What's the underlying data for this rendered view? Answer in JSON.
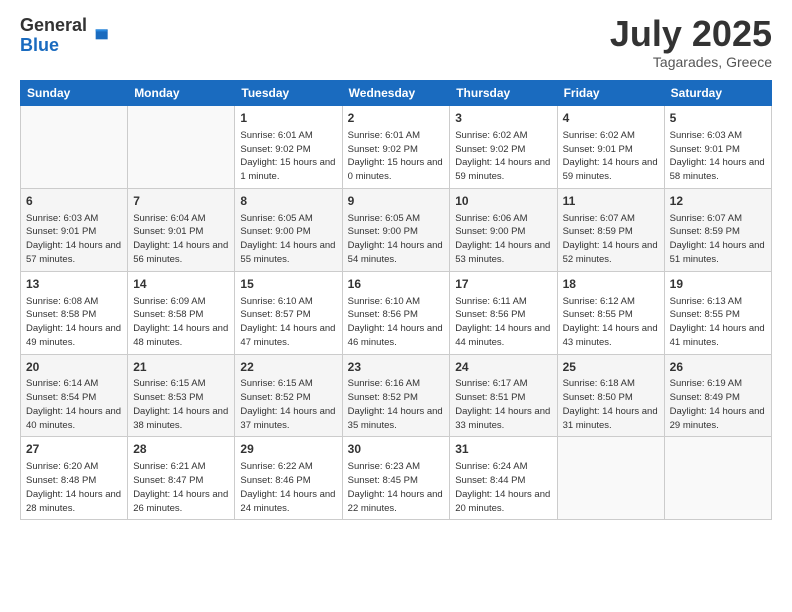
{
  "logo": {
    "general": "General",
    "blue": "Blue"
  },
  "header": {
    "month": "July 2025",
    "location": "Tagarades, Greece"
  },
  "weekdays": [
    "Sunday",
    "Monday",
    "Tuesday",
    "Wednesday",
    "Thursday",
    "Friday",
    "Saturday"
  ],
  "weeks": [
    [
      {
        "day": "",
        "info": ""
      },
      {
        "day": "",
        "info": ""
      },
      {
        "day": "1",
        "info": "Sunrise: 6:01 AM\nSunset: 9:02 PM\nDaylight: 15 hours and 1 minute."
      },
      {
        "day": "2",
        "info": "Sunrise: 6:01 AM\nSunset: 9:02 PM\nDaylight: 15 hours and 0 minutes."
      },
      {
        "day": "3",
        "info": "Sunrise: 6:02 AM\nSunset: 9:02 PM\nDaylight: 14 hours and 59 minutes."
      },
      {
        "day": "4",
        "info": "Sunrise: 6:02 AM\nSunset: 9:01 PM\nDaylight: 14 hours and 59 minutes."
      },
      {
        "day": "5",
        "info": "Sunrise: 6:03 AM\nSunset: 9:01 PM\nDaylight: 14 hours and 58 minutes."
      }
    ],
    [
      {
        "day": "6",
        "info": "Sunrise: 6:03 AM\nSunset: 9:01 PM\nDaylight: 14 hours and 57 minutes."
      },
      {
        "day": "7",
        "info": "Sunrise: 6:04 AM\nSunset: 9:01 PM\nDaylight: 14 hours and 56 minutes."
      },
      {
        "day": "8",
        "info": "Sunrise: 6:05 AM\nSunset: 9:00 PM\nDaylight: 14 hours and 55 minutes."
      },
      {
        "day": "9",
        "info": "Sunrise: 6:05 AM\nSunset: 9:00 PM\nDaylight: 14 hours and 54 minutes."
      },
      {
        "day": "10",
        "info": "Sunrise: 6:06 AM\nSunset: 9:00 PM\nDaylight: 14 hours and 53 minutes."
      },
      {
        "day": "11",
        "info": "Sunrise: 6:07 AM\nSunset: 8:59 PM\nDaylight: 14 hours and 52 minutes."
      },
      {
        "day": "12",
        "info": "Sunrise: 6:07 AM\nSunset: 8:59 PM\nDaylight: 14 hours and 51 minutes."
      }
    ],
    [
      {
        "day": "13",
        "info": "Sunrise: 6:08 AM\nSunset: 8:58 PM\nDaylight: 14 hours and 49 minutes."
      },
      {
        "day": "14",
        "info": "Sunrise: 6:09 AM\nSunset: 8:58 PM\nDaylight: 14 hours and 48 minutes."
      },
      {
        "day": "15",
        "info": "Sunrise: 6:10 AM\nSunset: 8:57 PM\nDaylight: 14 hours and 47 minutes."
      },
      {
        "day": "16",
        "info": "Sunrise: 6:10 AM\nSunset: 8:56 PM\nDaylight: 14 hours and 46 minutes."
      },
      {
        "day": "17",
        "info": "Sunrise: 6:11 AM\nSunset: 8:56 PM\nDaylight: 14 hours and 44 minutes."
      },
      {
        "day": "18",
        "info": "Sunrise: 6:12 AM\nSunset: 8:55 PM\nDaylight: 14 hours and 43 minutes."
      },
      {
        "day": "19",
        "info": "Sunrise: 6:13 AM\nSunset: 8:55 PM\nDaylight: 14 hours and 41 minutes."
      }
    ],
    [
      {
        "day": "20",
        "info": "Sunrise: 6:14 AM\nSunset: 8:54 PM\nDaylight: 14 hours and 40 minutes."
      },
      {
        "day": "21",
        "info": "Sunrise: 6:15 AM\nSunset: 8:53 PM\nDaylight: 14 hours and 38 minutes."
      },
      {
        "day": "22",
        "info": "Sunrise: 6:15 AM\nSunset: 8:52 PM\nDaylight: 14 hours and 37 minutes."
      },
      {
        "day": "23",
        "info": "Sunrise: 6:16 AM\nSunset: 8:52 PM\nDaylight: 14 hours and 35 minutes."
      },
      {
        "day": "24",
        "info": "Sunrise: 6:17 AM\nSunset: 8:51 PM\nDaylight: 14 hours and 33 minutes."
      },
      {
        "day": "25",
        "info": "Sunrise: 6:18 AM\nSunset: 8:50 PM\nDaylight: 14 hours and 31 minutes."
      },
      {
        "day": "26",
        "info": "Sunrise: 6:19 AM\nSunset: 8:49 PM\nDaylight: 14 hours and 29 minutes."
      }
    ],
    [
      {
        "day": "27",
        "info": "Sunrise: 6:20 AM\nSunset: 8:48 PM\nDaylight: 14 hours and 28 minutes."
      },
      {
        "day": "28",
        "info": "Sunrise: 6:21 AM\nSunset: 8:47 PM\nDaylight: 14 hours and 26 minutes."
      },
      {
        "day": "29",
        "info": "Sunrise: 6:22 AM\nSunset: 8:46 PM\nDaylight: 14 hours and 24 minutes."
      },
      {
        "day": "30",
        "info": "Sunrise: 6:23 AM\nSunset: 8:45 PM\nDaylight: 14 hours and 22 minutes."
      },
      {
        "day": "31",
        "info": "Sunrise: 6:24 AM\nSunset: 8:44 PM\nDaylight: 14 hours and 20 minutes."
      },
      {
        "day": "",
        "info": ""
      },
      {
        "day": "",
        "info": ""
      }
    ]
  ]
}
